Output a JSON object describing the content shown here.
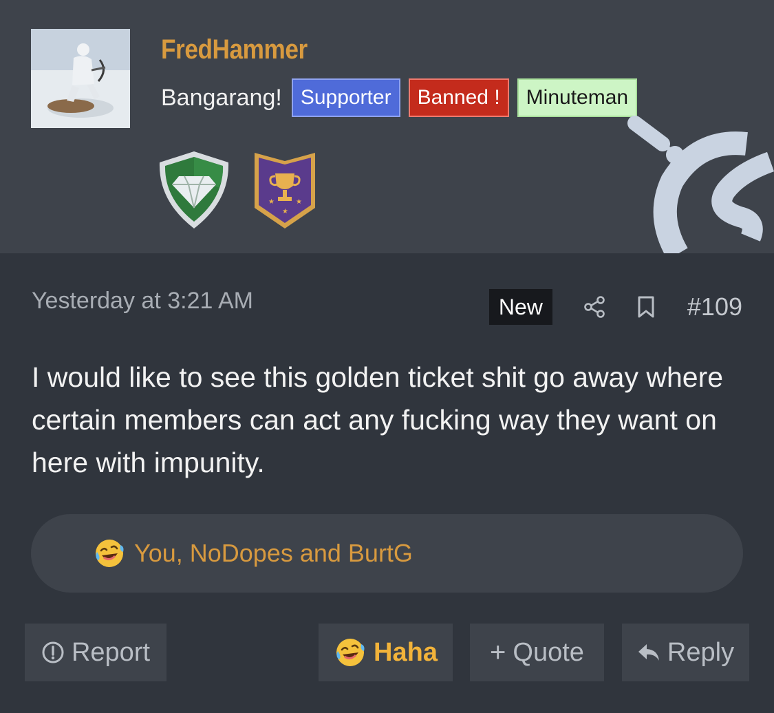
{
  "user": {
    "name": "FredHammer",
    "title": "Bangarang!",
    "banners": [
      {
        "label": "Supporter",
        "color": "#4f6bd9"
      },
      {
        "label": "Banned !",
        "color": "#c42b1c"
      },
      {
        "label": "Minuteman",
        "color": "#cdf5c5"
      }
    ],
    "trophies": [
      "diamond-shield-icon",
      "trophy-cup-icon"
    ]
  },
  "post": {
    "date": "Yesterday at 3:21 AM",
    "new_badge": "New",
    "number": "#109",
    "message": "I would like to see this golden ticket shit go away where certain members can act any fucking way they want on here with impunity."
  },
  "reactions": {
    "icon": "laughing-emoji-icon",
    "text": "You, NoDopes and BurtG"
  },
  "buttons": {
    "report": "Report",
    "haha": "Haha",
    "quote": "Quote",
    "reply": "Reply"
  },
  "colors": {
    "accent": "#d89a3f",
    "header_bg": "#3e434b",
    "body_bg": "#30353d"
  }
}
